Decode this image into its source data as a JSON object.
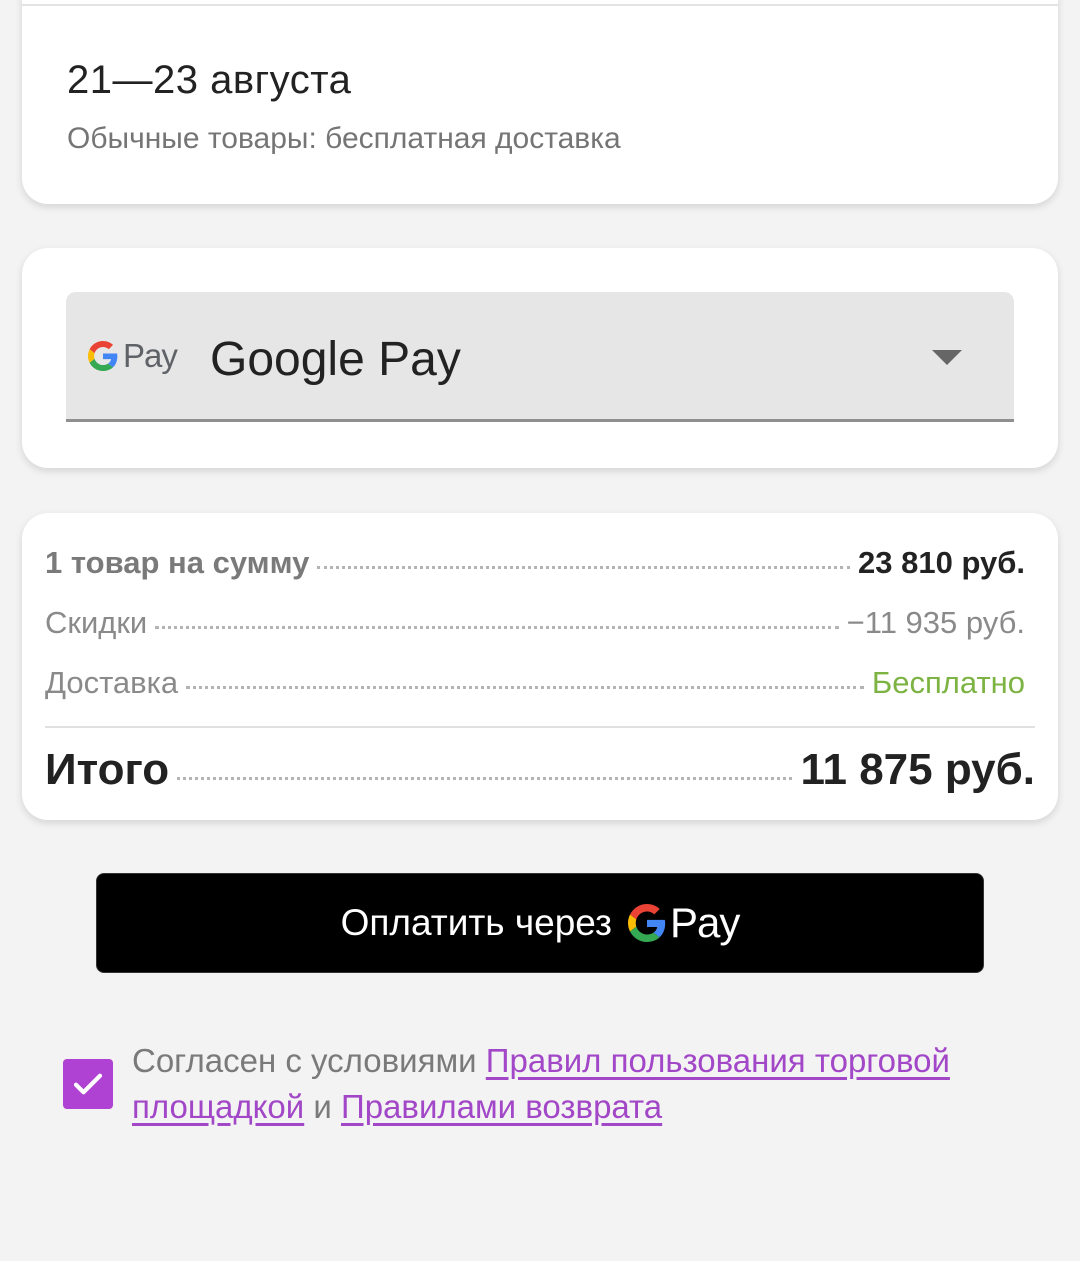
{
  "delivery": {
    "date": "21—23 августа",
    "note": "Обычные товары: бесплатная доставка"
  },
  "payment": {
    "logo_pay_word": "Pay",
    "selected_label": "Google Pay"
  },
  "summary": {
    "items_label": "1 товар на сумму",
    "items_value": "23 810 руб.",
    "discount_label": "Скидки",
    "discount_value": "−11 935 руб.",
    "delivery_label": "Доставка",
    "delivery_value": "Бесплатно",
    "total_label": "Итого",
    "total_value": "11 875 руб."
  },
  "pay_button": {
    "label": "Оплатить через",
    "pay_word": "Pay"
  },
  "agreement": {
    "checked": true,
    "prefix": "Согласен с условиями ",
    "link_terms": "Правил пользования торговой площадкой",
    "middle": " и ",
    "link_returns": "Правилами возврата"
  },
  "colors": {
    "accent": "#b042d3",
    "link": "#a247c7",
    "free_green": "#7cb342",
    "button_bg": "#000000"
  }
}
